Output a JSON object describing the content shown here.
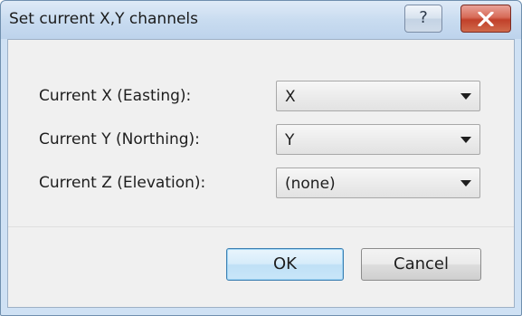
{
  "window": {
    "title": "Set current X,Y channels",
    "help_label": "?"
  },
  "fields": [
    {
      "label": "Current X (Easting):",
      "value": "X"
    },
    {
      "label": "Current Y (Northing):",
      "value": "Y"
    },
    {
      "label": "Current Z (Elevation):",
      "value": "(none)"
    }
  ],
  "buttons": {
    "ok_label": "OK",
    "cancel_label": "Cancel"
  },
  "icons": {
    "help": "help-icon",
    "close": "close-icon",
    "dropdown": "chevron-down-icon"
  },
  "colors": {
    "close_button": "#c9432e",
    "ok_button_border": "#3c7fb1"
  }
}
